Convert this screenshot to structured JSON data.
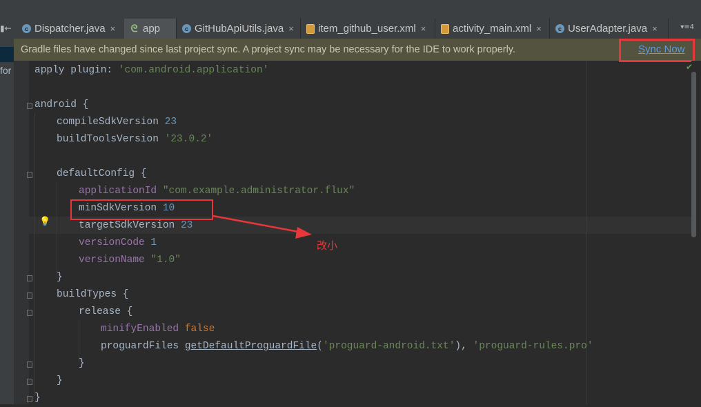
{
  "tabs": [
    {
      "label": "Dispatcher.java",
      "icon": "class-icon",
      "closable": true
    },
    {
      "label": "app",
      "icon": "gradle-icon",
      "active": true,
      "closable": false
    },
    {
      "label": "GitHubApiUtils.java",
      "icon": "class-icon",
      "closable": true
    },
    {
      "label": "item_github_user.xml",
      "icon": "xml-file-icon",
      "closable": true
    },
    {
      "label": "activity_main.xml",
      "icon": "xml-file-icon",
      "closable": true
    },
    {
      "label": "UserAdapter.java",
      "icon": "class-icon",
      "closable": true
    }
  ],
  "tab_close_glyph": "×",
  "tab_overflow_label": "▾≡4",
  "left_panel_text": "for",
  "banner": {
    "message": "Gradle files have changed since last project sync. A project sync may be necessary for the IDE to work properly.",
    "action": "Sync Now"
  },
  "code": {
    "apply_kw": "apply plugin: ",
    "apply_val": "'com.android.application'",
    "android_open": "android {",
    "compileSdk_key": "compileSdkVersion ",
    "compileSdk_val": "23",
    "buildTools_key": "buildToolsVersion ",
    "buildTools_val": "'23.0.2'",
    "defaultConfig_open": "defaultConfig {",
    "appId_key": "applicationId ",
    "appId_val": "\"com.example.administrator.flux\"",
    "minSdk_key": "minSdkVersion ",
    "minSdk_val": "10",
    "targetSdk_key": "targetSdkVersion ",
    "targetSdk_val": "23",
    "versionCode_key": "versionCode ",
    "versionCode_val": "1",
    "versionName_key": "versionName ",
    "versionName_val": "\"1.0\"",
    "close_brace": "}",
    "buildTypes_open": "buildTypes {",
    "release_open": "release {",
    "minify_key": "minifyEnabled ",
    "minify_val": "false",
    "proguard_key": "proguardFiles ",
    "proguard_fn": "getDefaultProguardFile",
    "proguard_args_open": "(",
    "proguard_arg1": "'proguard-android.txt'",
    "proguard_args_mid": "), ",
    "proguard_arg2": "'proguard-rules.pro'"
  },
  "annotation": {
    "text": "改小",
    "color": "#e8373a"
  },
  "colors": {
    "accent_red": "#e8373a",
    "link": "#5f9bd9",
    "editor_bg": "#2b2b2b",
    "banner_bg": "#54533f"
  }
}
